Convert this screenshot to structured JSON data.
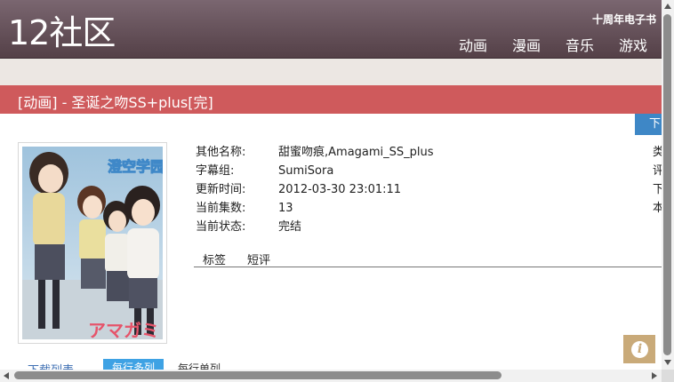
{
  "header": {
    "logo": "12社区",
    "topline": "十周年电子书",
    "nav": [
      "动画",
      "漫画",
      "音乐",
      "游戏"
    ]
  },
  "title": "[动画] - 圣诞之吻SS+plus[完]",
  "download_button": "下",
  "cover": {
    "caption_top": "澄空学园",
    "caption_bottom": "アマガミ"
  },
  "info": [
    {
      "label": "其他名称:",
      "value": "甜蜜吻痕,Amagami_SS_plus"
    },
    {
      "label": "字幕组:",
      "value": "SumiSora"
    },
    {
      "label": "更新时间:",
      "value": "2012-03-30 23:01:11"
    },
    {
      "label": "当前集数:",
      "value": "13"
    },
    {
      "label": "当前状态:",
      "value": "完结"
    }
  ],
  "info_edge": [
    "类",
    "评",
    "下",
    "本"
  ],
  "tabs": [
    "标签",
    "短评"
  ],
  "bottom": {
    "download_list": "下载列表",
    "order_active": "每行多列",
    "order_single": "每行单列"
  },
  "colors": {
    "header": "#5f4a52",
    "title_bar": "#cf5a5c",
    "accent_blue": "#3e87c6",
    "info_button": "#c9aa79"
  }
}
